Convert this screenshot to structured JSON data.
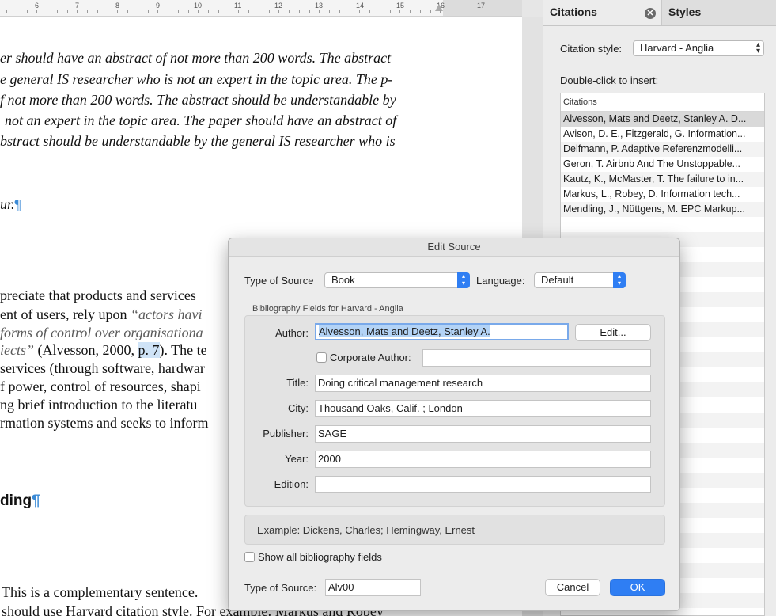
{
  "ruler": {
    "numbers": [
      "6",
      "7",
      "8",
      "9",
      "10",
      "11",
      "12",
      "13",
      "14",
      "15",
      "16",
      "17"
    ]
  },
  "document": {
    "lines": [
      {
        "text": "er should have an abstract of not more than 200 words. The abstract",
        "italic": true
      },
      {
        "text": "e general IS researcher who is not an expert in the topic area. The p-",
        "italic": true
      },
      {
        "text": "f not more than 200 words. The abstract should be understandable by",
        "italic": true
      },
      {
        "text": "not an expert in the topic area. The paper should have an abstract of",
        "italic": true
      },
      {
        "text": "bstract should be understandable by the general IS researcher who is",
        "italic": true
      }
    ],
    "line_ur": "ur.",
    "pilcrow": "¶",
    "p2": {
      "l1": "preciate that products and services",
      "l2_a": "ent of users, rely upon ",
      "l2_b": "“actors havi",
      "l3": "forms of control over organisationa",
      "l4_a": "iects”",
      "l4_b": " (Alvesson, 2000, ",
      "l4_c": "p. 7",
      "l4_d": "). The te",
      "l5": "services (through software, hardwar",
      "l6": "f power, control of resources, shapi",
      "l7": "ng brief introduction to the literatu",
      "l8": "rmation systems and seeks to inform"
    },
    "heading": "ding",
    "bottom1": "This is a complementary sentence.",
    "bottom2": "should use Harvard citation style. For example: Markus and Robey"
  },
  "panel": {
    "tab_citations": "Citations",
    "tab_styles": "Styles",
    "style_label": "Citation style:",
    "style_value": "Harvard - Anglia",
    "insert_label": "Double-click to insert:",
    "list_header": "Citations",
    "items": [
      "Alvesson, Mats and Deetz, Stanley A. D...",
      "Avison, D. E.,  Fitzgerald, G. Information...",
      "Delfmann, P. Adaptive Referenzmodelli...",
      "Geron, T. Airbnb And The Unstoppable...",
      "Kautz, K.,  McMaster, T. The failure to in...",
      "Markus, L.,  Robey, D. Information tech...",
      "Mendling, J.,  Nüttgens, M. EPC Markup..."
    ]
  },
  "dialog": {
    "title": "Edit Source",
    "type_label": "Type of Source",
    "type_value": "Book",
    "language_label": "Language:",
    "language_value": "Default",
    "fields_heading": "Bibliography Fields for Harvard - Anglia",
    "author_label": "Author:",
    "author_value": "Alvesson, Mats and Deetz, Stanley A.",
    "edit_button": "Edit...",
    "corporate_label": "Corporate Author:",
    "title_label": "Title:",
    "title_value": "Doing critical management research",
    "city_label": "City:",
    "city_value": "Thousand Oaks, Calif. ; London",
    "publisher_label": "Publisher:",
    "publisher_value": "SAGE",
    "year_label": "Year:",
    "year_value": "2000",
    "edition_label": "Edition:",
    "edition_value": "",
    "example": "Example: Dickens, Charles; Hemingway, Ernest",
    "show_all": "Show all bibliography fields",
    "tag_label": "Type of Source:",
    "tag_value": "Alv00",
    "cancel": "Cancel",
    "ok": "OK"
  }
}
